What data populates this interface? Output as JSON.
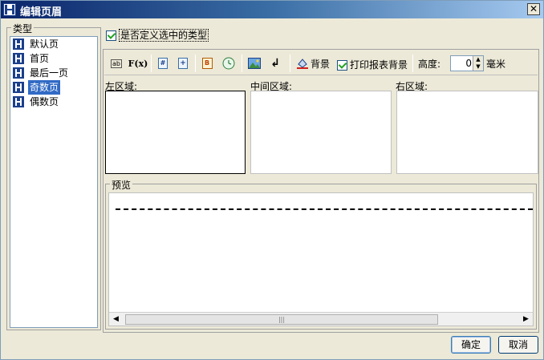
{
  "window": {
    "title": "编辑页眉",
    "close_label": "✕"
  },
  "type_group": {
    "legend": "类型",
    "items": [
      {
        "label": "默认页",
        "selected": false
      },
      {
        "label": "首页",
        "selected": false
      },
      {
        "label": "最后一页",
        "selected": false
      },
      {
        "label": "奇数页",
        "selected": true
      },
      {
        "label": "偶数页",
        "selected": false
      }
    ]
  },
  "custom_type": {
    "label": "是否定义选中的类型",
    "checked": true
  },
  "toolbar": {
    "text_icon_label": "ab",
    "formula_icon_label": "F(x)",
    "page_number_icon_label": "#",
    "total_pages_icon_label": "+",
    "date_icon_label": "B",
    "newline_icon_label": "↲",
    "background_label": "背景",
    "print_background_label": "打印报表背景",
    "print_background_checked": true,
    "height_label": "高度:",
    "height_value": "0",
    "unit_label": "毫米"
  },
  "regions": {
    "left_label": "左区域:",
    "middle_label": "中间区域:",
    "right_label": "右区域:"
  },
  "preview": {
    "legend": "预览",
    "scroll_thumb_grip": "|||"
  },
  "buttons": {
    "ok": "确定",
    "cancel": "取消"
  },
  "colors": {
    "selection": "#316ac5",
    "titlebar": "#0a246a"
  }
}
